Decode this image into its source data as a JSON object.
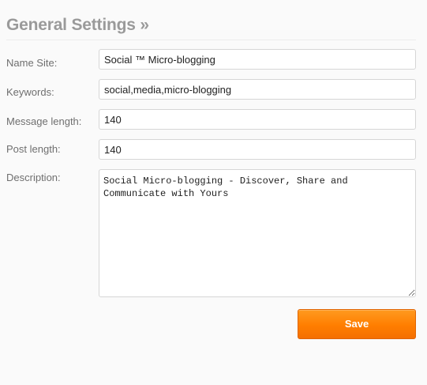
{
  "header": {
    "title": "General Settings »"
  },
  "form": {
    "name_site": {
      "label": "Name Site:",
      "value": "Social ™ Micro-blogging"
    },
    "keywords": {
      "label": "Keywords:",
      "value": "social,media,micro-blogging"
    },
    "message_length": {
      "label": "Message length:",
      "value": "140"
    },
    "post_length": {
      "label": "Post length:",
      "value": "140"
    },
    "description": {
      "label": "Description:",
      "value": "Social Micro-blogging - Discover, Share and Communicate with Yours"
    },
    "save_label": "Save"
  },
  "colors": {
    "title": "#9a9a9a",
    "save_button": "#ff7e00"
  }
}
